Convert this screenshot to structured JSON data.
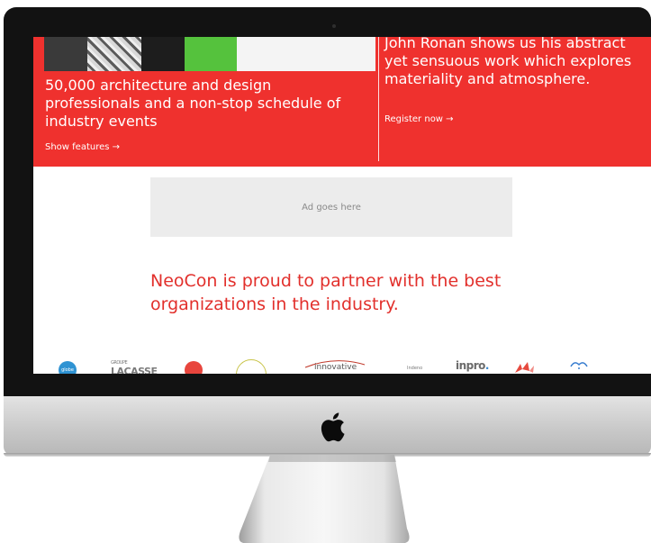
{
  "hero": {
    "left_heading": "50,000 architecture and design professionals and a non-stop schedule of industry events",
    "left_link": "Show features →",
    "right_heading": "John Ronan shows us his abstract yet sensuous work which explores materiality and atmosphere.",
    "right_link": "Register now →"
  },
  "ad": {
    "text": "Ad goes here"
  },
  "partners": {
    "heading": "NeoCon is proud to partner with the best organizations in the industry.",
    "logos": {
      "globe": "globe",
      "lacasse_small": "GROUPE",
      "lacasse": "LACASSE",
      "innovative": "innovative",
      "indeno": "Indeno",
      "inpro_a": "inpro",
      "inpro_b": "."
    }
  },
  "colors": {
    "accent_red": "#ef312e",
    "partner_text_red": "#e2302c",
    "ad_background": "#ececec"
  },
  "icons": {
    "apple": "apple-logo-icon"
  }
}
